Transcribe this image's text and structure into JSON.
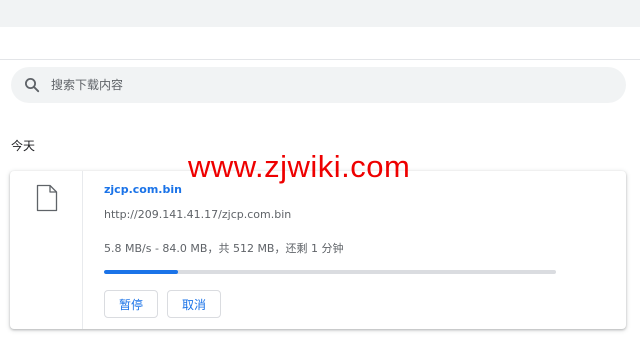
{
  "search": {
    "placeholder": "搜索下载内容"
  },
  "date_section": {
    "label": "今天"
  },
  "watermark": {
    "text": "www.zjwiki.com"
  },
  "download": {
    "file_name": "zjcp.com.bin",
    "url": "http://209.141.41.17/zjcp.com.bin",
    "status": "5.8 MB/s - 84.0 MB，共 512 MB，还剩 1 分钟",
    "progress_fraction": 0.164,
    "pause_label": "暂停",
    "cancel_label": "取消"
  },
  "colors": {
    "accent": "#1a73e8",
    "watermark": "#ee0000",
    "search_bg": "#f1f3f4",
    "progress_track": "#dadce0"
  },
  "icons": {
    "search": "search-icon",
    "file": "file-icon"
  }
}
